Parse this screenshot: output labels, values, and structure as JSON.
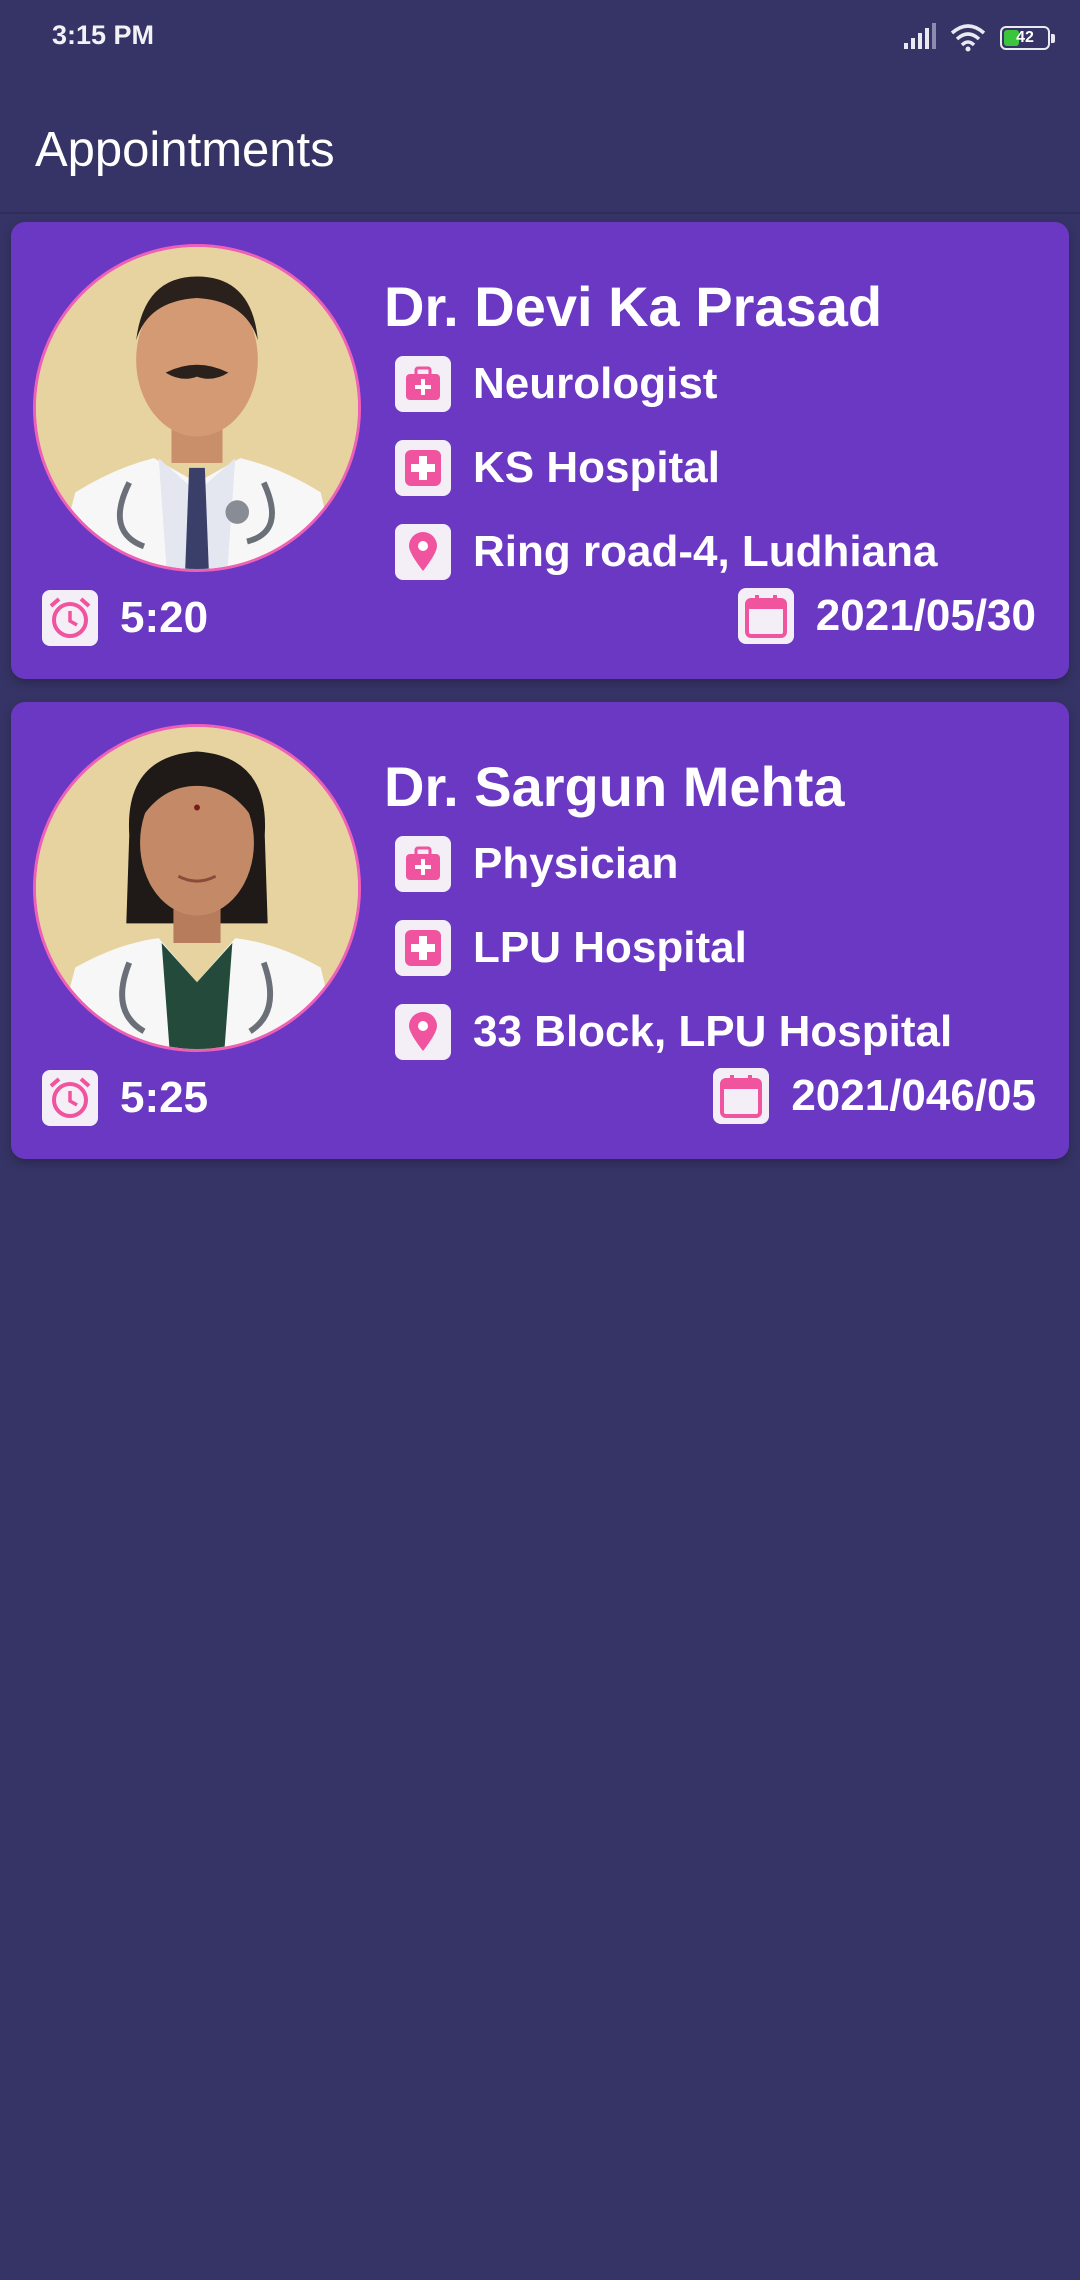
{
  "status_bar": {
    "time": "3:15 PM",
    "battery": "42",
    "battery_level": 0.42,
    "icons": [
      "signal-icon",
      "wifi-icon",
      "battery-icon"
    ]
  },
  "app_bar": {
    "title": "Appointments"
  },
  "colors": {
    "background": "#363466",
    "card": "#6a38c2",
    "icon_accent": "#f0549e",
    "icon_tile": "#f4eef7"
  },
  "appointments": [
    {
      "doctor_name": "Dr. Devi Ka Prasad",
      "specialty": "Neurologist",
      "hospital": "KS Hospital",
      "address": "Ring road-4, Ludhiana",
      "time": "5:20",
      "date": "2021/05/30"
    },
    {
      "doctor_name": "Dr. Sargun Mehta",
      "specialty": "Physician",
      "hospital": "LPU Hospital",
      "address": "33 Block, LPU Hospital",
      "time": "5:25",
      "date": "2021/046/05"
    }
  ]
}
